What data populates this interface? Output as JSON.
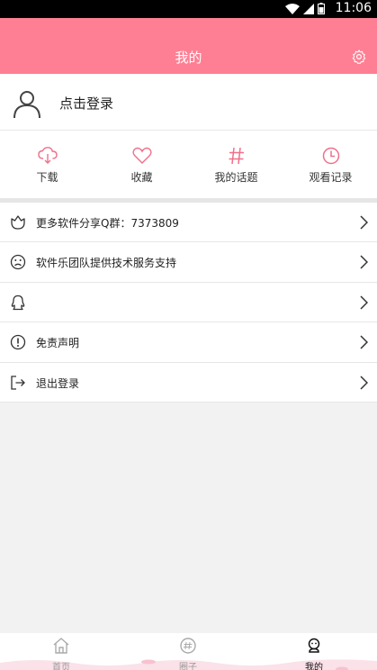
{
  "status_bar": {
    "time": "11:06"
  },
  "header": {
    "title": "我的",
    "settings_icon": "gear-icon"
  },
  "user": {
    "login_label": "点击登录",
    "avatar_icon": "user-icon"
  },
  "quick_actions": [
    {
      "label": "下载",
      "icon": "cloud-download-icon"
    },
    {
      "label": "收藏",
      "icon": "heart-icon"
    },
    {
      "label": "我的话题",
      "icon": "hash-icon"
    },
    {
      "label": "观看记录",
      "icon": "clock-icon"
    }
  ],
  "menu": [
    {
      "label": "更多软件分享Q群：7373809",
      "icon": "flower-icon"
    },
    {
      "label": "软件乐团队提供技术服务支持",
      "icon": "sad-face-icon"
    },
    {
      "label": "",
      "icon": "qq-icon"
    },
    {
      "label": "免责声明",
      "icon": "info-icon"
    },
    {
      "label": "退出登录",
      "icon": "logout-icon"
    }
  ],
  "tabs": [
    {
      "label": "首页",
      "icon": "home-icon"
    },
    {
      "label": "圈子",
      "icon": "circle-icon"
    },
    {
      "label": "我的",
      "icon": "profile-icon",
      "active": true
    }
  ],
  "colors": {
    "accent": "#fe7f93",
    "background": "#f2f2f2"
  }
}
